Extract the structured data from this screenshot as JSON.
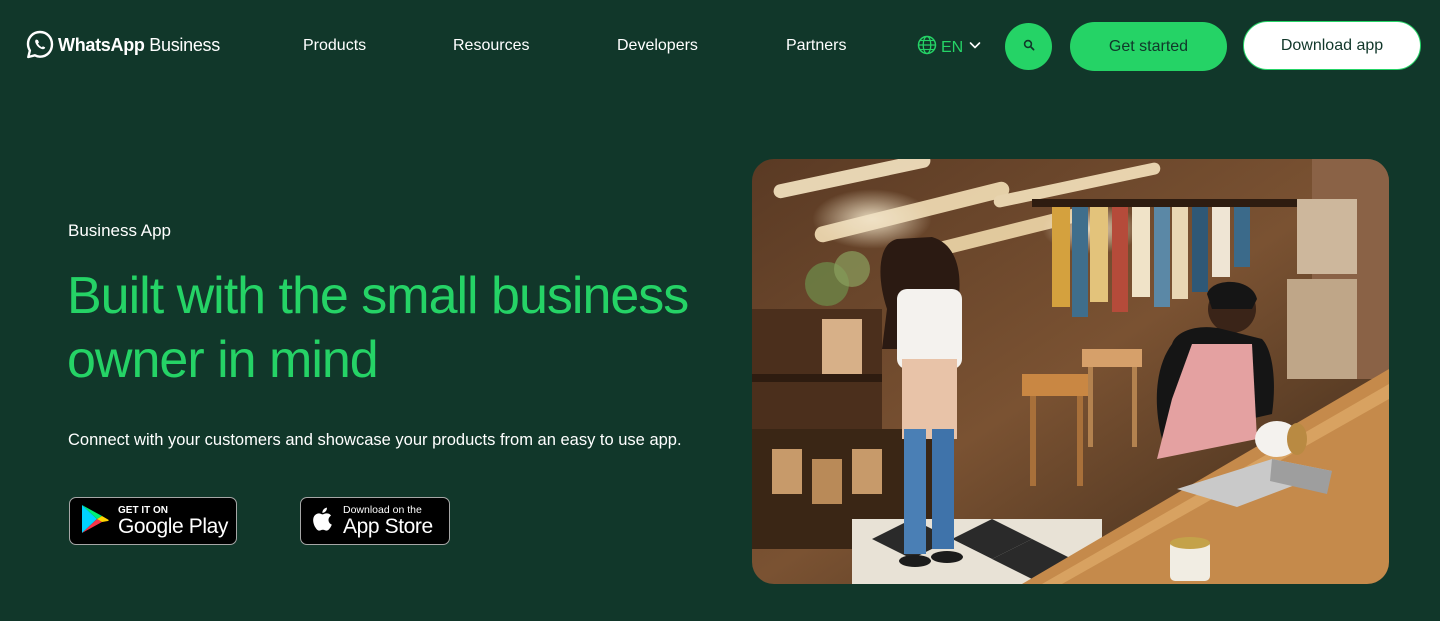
{
  "header": {
    "logo": {
      "brand": "WhatsApp",
      "suffix": " Business",
      "icon": "whatsapp-icon"
    },
    "nav": [
      "Products",
      "Resources",
      "Developers",
      "Partners"
    ],
    "language": {
      "label": "EN",
      "icon": "globe-icon"
    },
    "search_icon": "search-icon",
    "get_started_label": "Get started",
    "download_label": "Download app"
  },
  "hero": {
    "eyebrow": "Business App",
    "headline": "Built with the small business owner in mind",
    "subtext": "Connect with your customers and showcase your products from an easy to use app.",
    "google_play": {
      "small": "GET IT ON",
      "big": "Google Play"
    },
    "app_store": {
      "small": "Download on the",
      "big": "App Store"
    },
    "image_alt": "photo-of-small-shop-owners"
  },
  "colors": {
    "background": "#11372a",
    "accent": "#25d366",
    "text": "#ffffff"
  }
}
